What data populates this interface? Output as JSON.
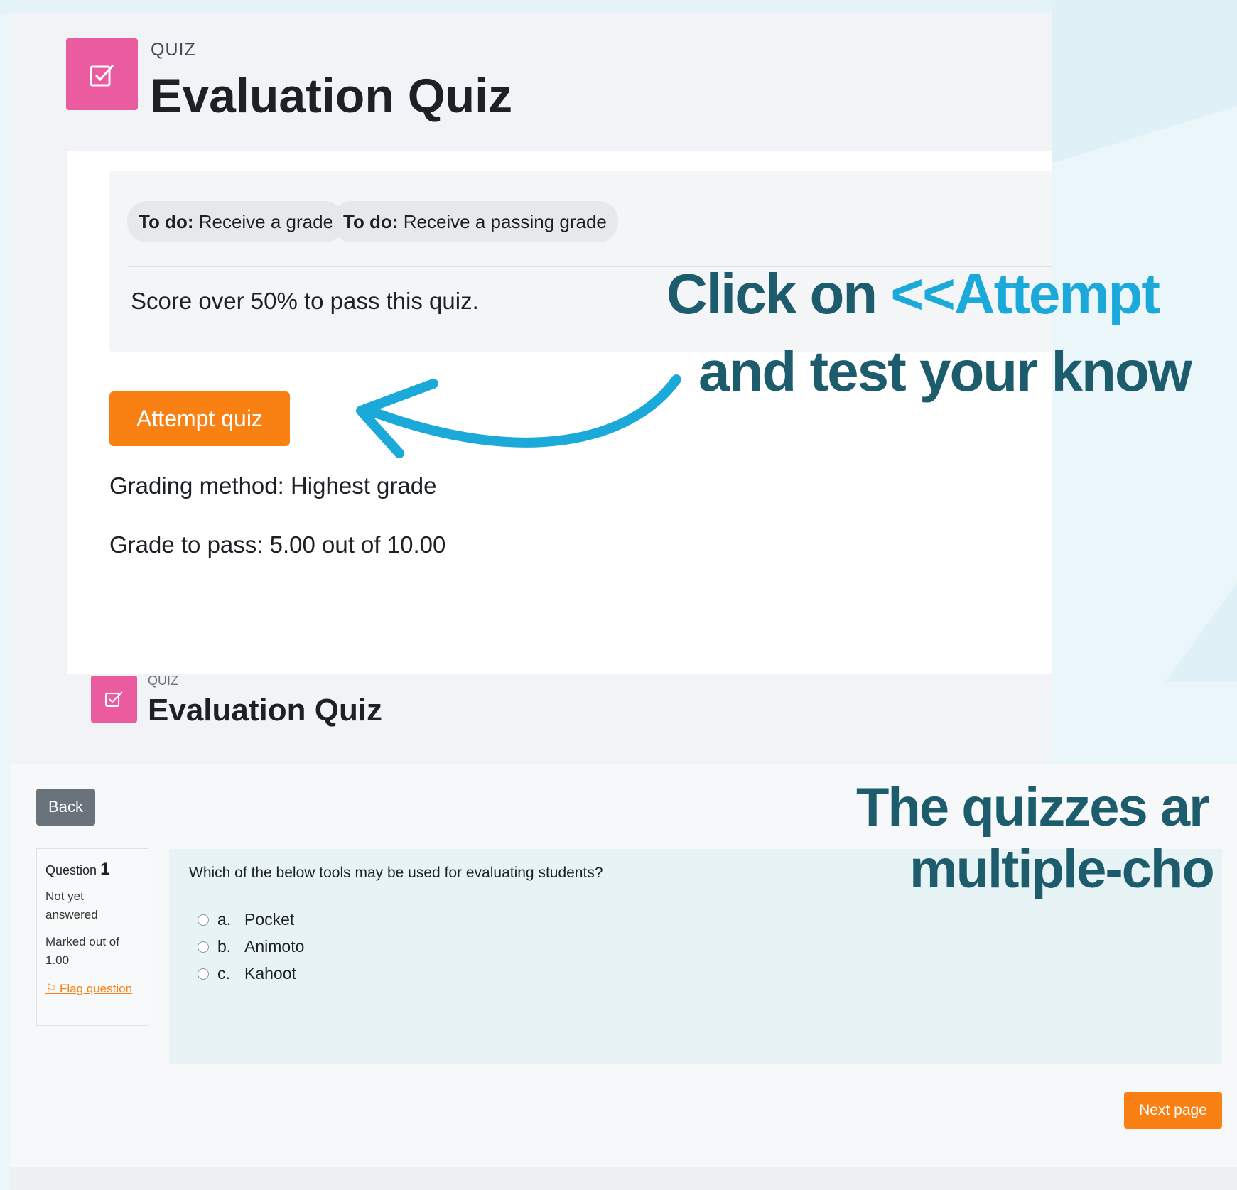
{
  "quiz_header": {
    "activity_type": "QUIZ",
    "title": "Evaluation Quiz"
  },
  "completion": {
    "badges": [
      {
        "prefix": "To do:",
        "text": " Receive a grade"
      },
      {
        "prefix": "To do:",
        "text": " Receive a passing grade"
      }
    ],
    "pass_note": "Score over 50% to pass this quiz."
  },
  "actions": {
    "attempt_label": "Attempt quiz"
  },
  "summary": {
    "grading_method": "Grading method: Highest grade",
    "grade_to_pass": "Grade to pass: 5.00 out of 10.00"
  },
  "quiz_header_small": {
    "activity_type": "QUIZ",
    "title": "Evaluation Quiz"
  },
  "attempt": {
    "back_label": "Back",
    "question_label": "Question",
    "question_number": "1",
    "state": "Not yet answered",
    "marked": "Marked out of 1.00",
    "flag_label": "Flag question",
    "question_text": "Which of the below tools may be used for evaluating students?",
    "answers": [
      {
        "letter": "a.",
        "text": "Pocket"
      },
      {
        "letter": "b.",
        "text": "Animoto"
      },
      {
        "letter": "c.",
        "text": "Kahoot"
      }
    ],
    "next_label": "Next page"
  },
  "annotations": {
    "callout1_line1_a": "Click on ",
    "callout1_line1_b": "<<Attempt",
    "callout1_line2": "and test your know",
    "callout2_line1": "The quizzes ar",
    "callout2_line2": "multiple-cho"
  },
  "colors": {
    "accent_orange": "#f98012",
    "quiz_icon_pink": "#ea5ba0",
    "callout_dark": "#1d5c6d",
    "callout_highlight": "#1ba9d9"
  },
  "icons": {
    "quiz_icon": "checkbox-edit-icon",
    "flag_icon": "flag-icon",
    "arrow": "curved-arrow-icon"
  }
}
